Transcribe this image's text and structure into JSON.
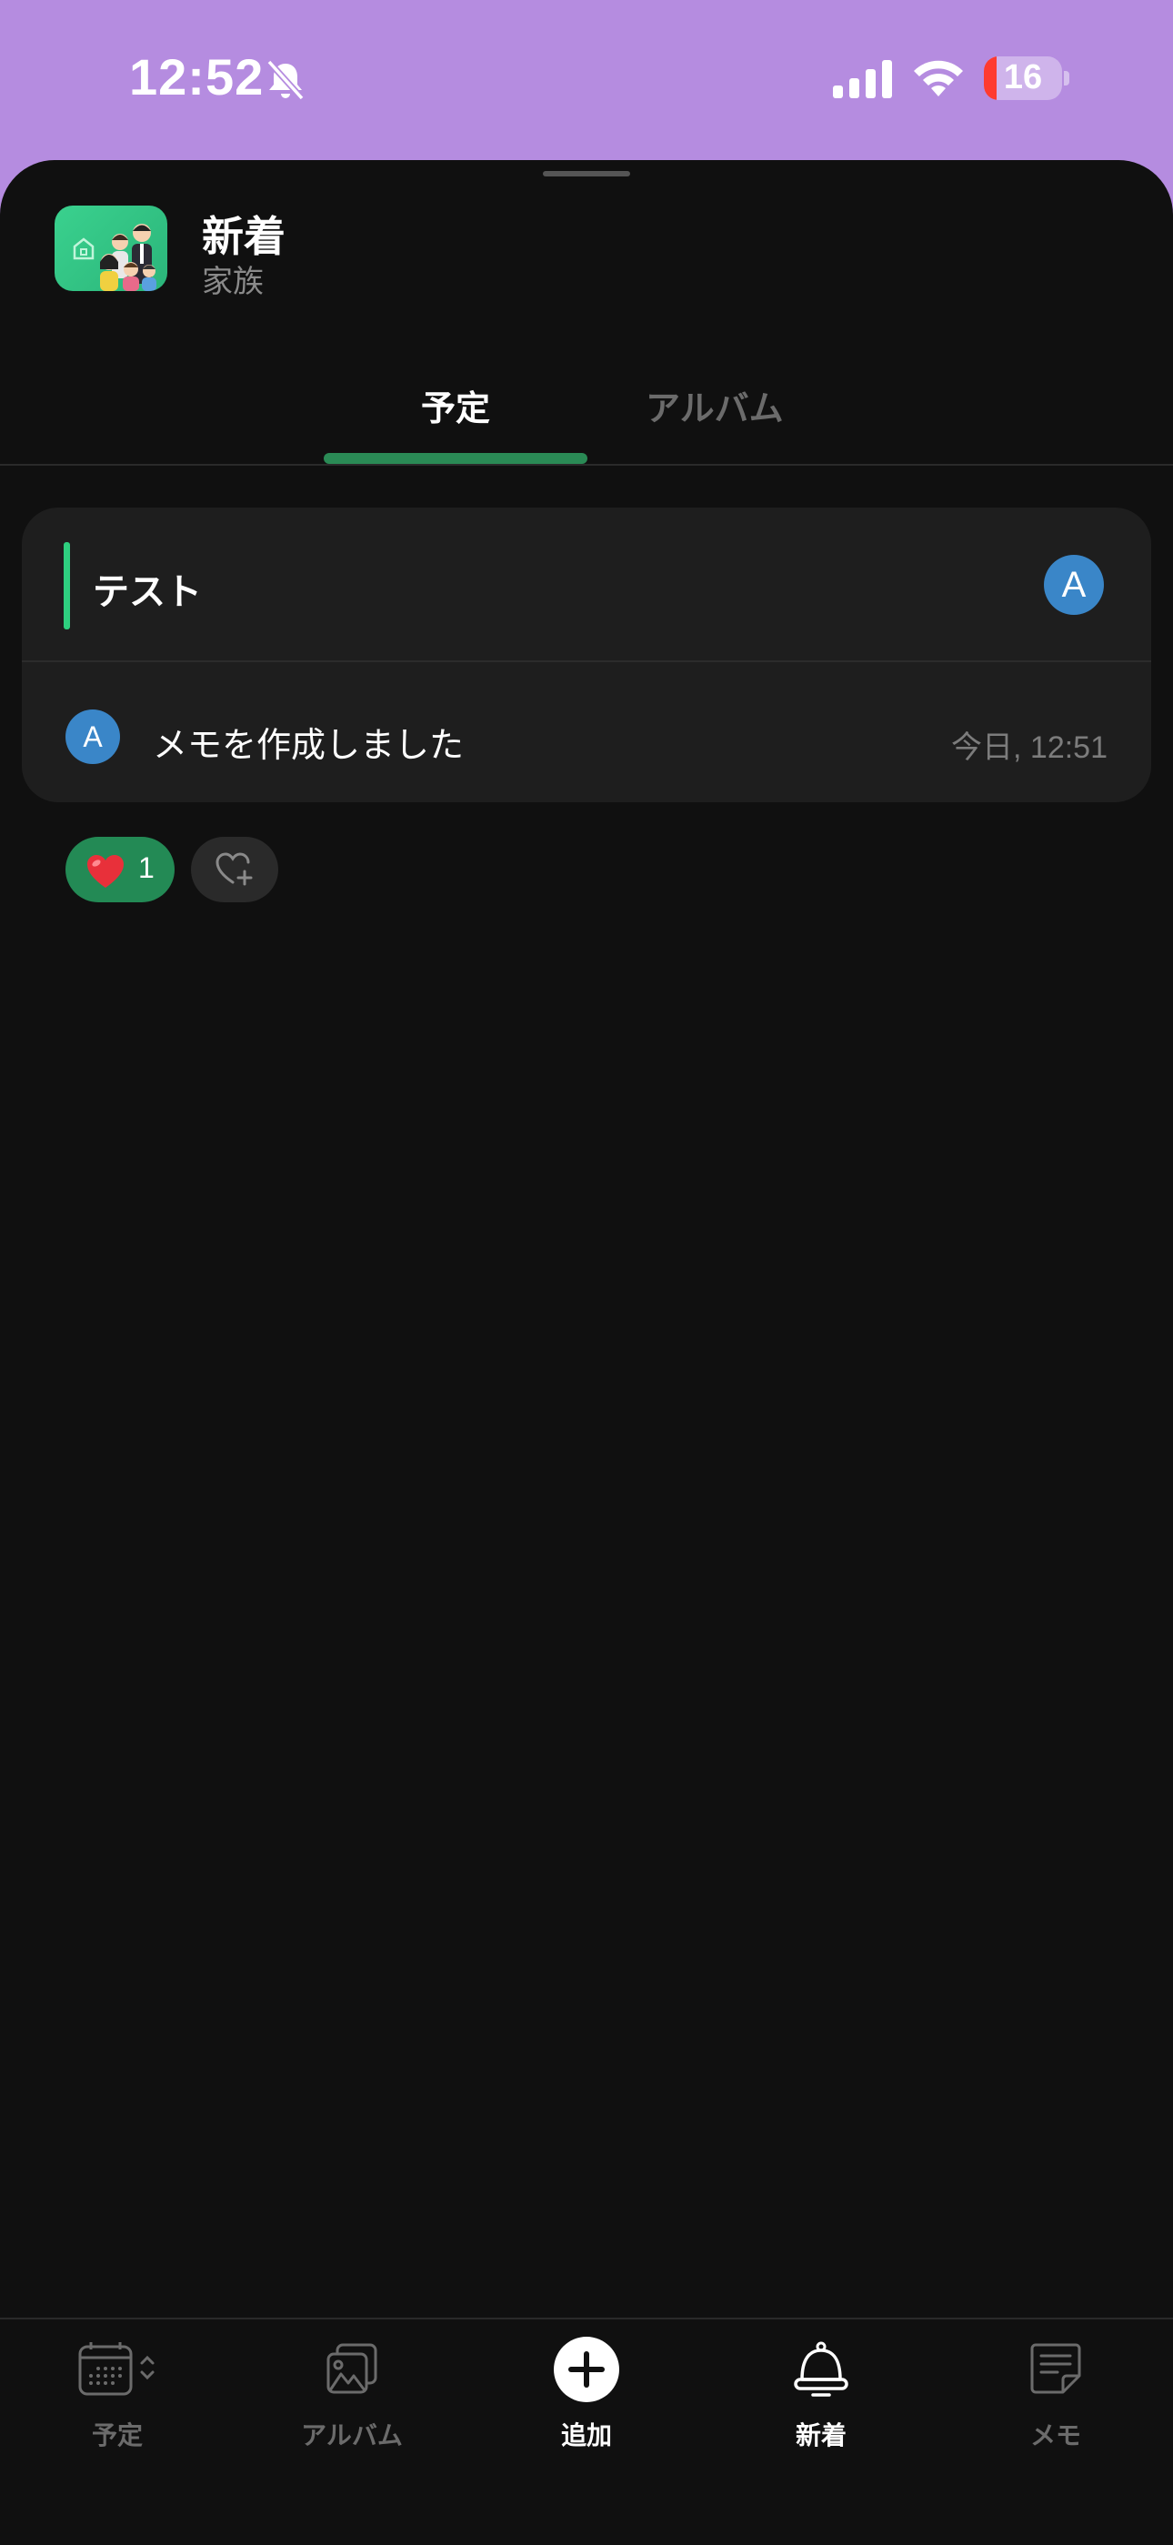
{
  "status_bar": {
    "time": "12:52",
    "battery": "16"
  },
  "header": {
    "title": "新着",
    "subtitle": "家族",
    "app_icon": "family-app-icon"
  },
  "tabs": [
    {
      "label": "予定",
      "selected": true
    },
    {
      "label": "アルバム",
      "selected": false
    }
  ],
  "card": {
    "title": "テスト",
    "author_initial": "A",
    "activity": {
      "author_initial": "A",
      "text": "メモを作成しました",
      "time": "今日, 12:51"
    }
  },
  "reactions": {
    "heart_count": "1"
  },
  "bottom_nav": {
    "items": [
      {
        "label": "予定",
        "icon": "calendar-icon",
        "active": false
      },
      {
        "label": "アルバム",
        "icon": "photo-album-icon",
        "active": false
      },
      {
        "label": "追加",
        "icon": "add-icon",
        "active": true
      },
      {
        "label": "新着",
        "icon": "bell-icon",
        "active": true
      },
      {
        "label": "メモ",
        "icon": "memo-icon",
        "active": false
      }
    ]
  },
  "colors": {
    "accent_green": "#2a8a55",
    "avatar_blue": "#3a86c8",
    "status_bar_bg": "#b58ce0",
    "background": "#101010"
  }
}
